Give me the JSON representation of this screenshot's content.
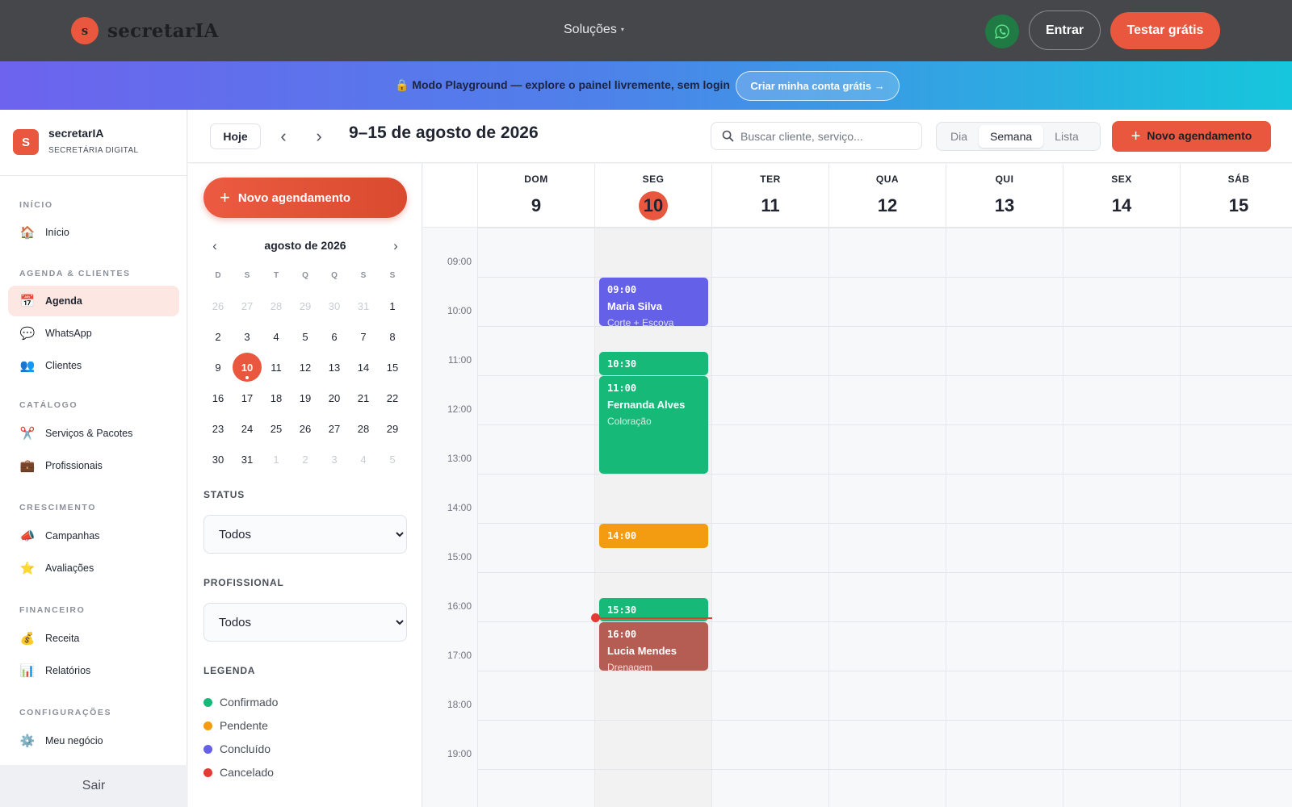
{
  "topnav": {
    "logo_letter": "s",
    "brand": "secretarIA",
    "menu_solucoes": "Soluções",
    "caret": "▾",
    "entrar": "Entrar",
    "testar": "Testar grátis"
  },
  "banner": {
    "text": "🔒 Modo Playground — explore o painel livremente, sem login",
    "cta": "Criar minha conta grátis →"
  },
  "sidebar": {
    "logo_letter": "S",
    "title": "secretarIA",
    "subtitle": "SECRETÁRIA DIGITAL",
    "sections": {
      "inicio": "INÍCIO",
      "agenda": "AGENDA & CLIENTES",
      "catalogo": "CATÁLOGO",
      "crescimento": "CRESCIMENTO",
      "financeiro": "FINANCEIRO",
      "config": "CONFIGURAÇÕES"
    },
    "items": {
      "inicio": {
        "icon": "🏠",
        "label": "Início"
      },
      "agenda": {
        "icon": "📅",
        "label": "Agenda"
      },
      "whatsapp": {
        "icon": "💬",
        "label": "WhatsApp"
      },
      "clientes": {
        "icon": "👥",
        "label": "Clientes"
      },
      "servicos": {
        "icon": "✂️",
        "label": "Serviços & Pacotes"
      },
      "profissionais": {
        "icon": "💼",
        "label": "Profissionais"
      },
      "campanhas": {
        "icon": "📣",
        "label": "Campanhas"
      },
      "avaliacoes": {
        "icon": "⭐",
        "label": "Avaliações"
      },
      "receita": {
        "icon": "💰",
        "label": "Receita"
      },
      "relatorios": {
        "icon": "📊",
        "label": "Relatórios"
      },
      "negocio": {
        "icon": "⚙️",
        "label": "Meu negócio"
      }
    },
    "sair": "Sair"
  },
  "toolbar": {
    "hoje": "Hoje",
    "prev": "‹",
    "next": "›",
    "range": "9–15 de agosto de 2026",
    "search_placeholder": "Buscar cliente, serviço...",
    "views": [
      "Dia",
      "Semana",
      "Lista"
    ],
    "active_view": "Semana",
    "novo": "Novo agendamento",
    "plus": "+"
  },
  "leftpanel": {
    "novo": "Novo agendamento",
    "plus": "+",
    "mini_calendar": {
      "title": "agosto de 2026",
      "prev": "‹",
      "next": "›",
      "weekdays": [
        "D",
        "S",
        "T",
        "Q",
        "Q",
        "S",
        "S"
      ],
      "weeks": [
        [
          "26",
          "27",
          "28",
          "29",
          "30",
          "31",
          "1"
        ],
        [
          "2",
          "3",
          "4",
          "5",
          "6",
          "7",
          "8"
        ],
        [
          "9",
          "10",
          "11",
          "12",
          "13",
          "14",
          "15"
        ],
        [
          "16",
          "17",
          "18",
          "19",
          "20",
          "21",
          "22"
        ],
        [
          "23",
          "24",
          "25",
          "26",
          "27",
          "28",
          "29"
        ],
        [
          "30",
          "31",
          "1",
          "2",
          "3",
          "4",
          "5"
        ]
      ],
      "today": "10"
    },
    "status_label": "STATUS",
    "status_value": "Todos",
    "profissional_label": "PROFISSIONAL",
    "profissional_value": "Todos",
    "legend_label": "LEGENDA",
    "legend": [
      {
        "label": "Confirmado",
        "color": "#16b978"
      },
      {
        "label": "Pendente",
        "color": "#f39c12"
      },
      {
        "label": "Concluído",
        "color": "#6460e8"
      },
      {
        "label": "Cancelado",
        "color": "#e23d35"
      }
    ]
  },
  "week": {
    "days": [
      {
        "dow": "DOM",
        "num": "9"
      },
      {
        "dow": "SEG",
        "num": "10",
        "today": true
      },
      {
        "dow": "TER",
        "num": "11"
      },
      {
        "dow": "QUA",
        "num": "12"
      },
      {
        "dow": "QUI",
        "num": "13"
      },
      {
        "dow": "SEX",
        "num": "14"
      },
      {
        "dow": "SÁB",
        "num": "15"
      }
    ],
    "hours": [
      "09:00",
      "10:00",
      "11:00",
      "12:00",
      "13:00",
      "14:00",
      "15:00",
      "16:00",
      "17:00",
      "18:00",
      "19:00"
    ],
    "events": [
      {
        "day": 1,
        "start": "09:00",
        "end": "10:00",
        "time": "09:00",
        "name": "Maria Silva",
        "service": "Corte + Escova",
        "status": "concluido"
      },
      {
        "day": 1,
        "start": "10:30",
        "end": "11:00",
        "time": "10:30",
        "name": "",
        "service": "",
        "status": "confirmado"
      },
      {
        "day": 1,
        "start": "11:00",
        "end": "13:00",
        "time": "11:00",
        "name": "Fernanda Alves",
        "service": "Coloração",
        "status": "confirmado"
      },
      {
        "day": 1,
        "start": "14:00",
        "end": "14:30",
        "time": "14:00",
        "name": "",
        "service": "",
        "status": "pendente"
      },
      {
        "day": 1,
        "start": "15:30",
        "end": "16:00",
        "time": "15:30",
        "name": "",
        "service": "",
        "status": "confirmado"
      },
      {
        "day": 1,
        "start": "16:00",
        "end": "17:00",
        "time": "16:00",
        "name": "Lucia Mendes",
        "service": "Drenagem",
        "status": "cancelado"
      }
    ],
    "now": "16:00"
  }
}
